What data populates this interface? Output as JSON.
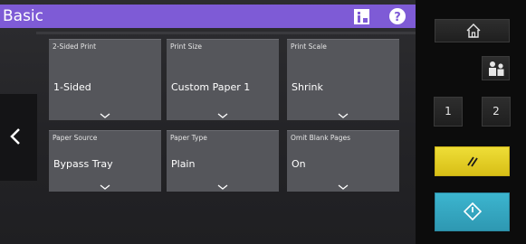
{
  "header": {
    "title": "Basic",
    "info_icon": "info-icon",
    "help_icon": "help-icon",
    "color": "#7e5bd6"
  },
  "navigation": {
    "back_icon": "chevron-left-icon"
  },
  "settings": {
    "two_sided_print": {
      "label": "2-Sided Print",
      "value": "1-Sided"
    },
    "print_size": {
      "label": "Print Size",
      "value": "Custom Paper 1"
    },
    "print_scale": {
      "label": "Print Scale",
      "value": "Shrink"
    },
    "paper_source": {
      "label": "Paper Source",
      "value": "Bypass Tray"
    },
    "paper_type": {
      "label": "Paper Type",
      "value": "Plain"
    },
    "omit_blank_pages": {
      "label": "Omit Blank Pages",
      "value": "On"
    }
  },
  "hard_keys": {
    "home_icon": "home-icon",
    "users_icon": "users-icon",
    "one_label": "1",
    "two_label": "2",
    "reset_icon": "reset-icon",
    "reset_color": "#e6cf22",
    "start_icon": "start-icon",
    "start_color": "#35a8c2"
  }
}
